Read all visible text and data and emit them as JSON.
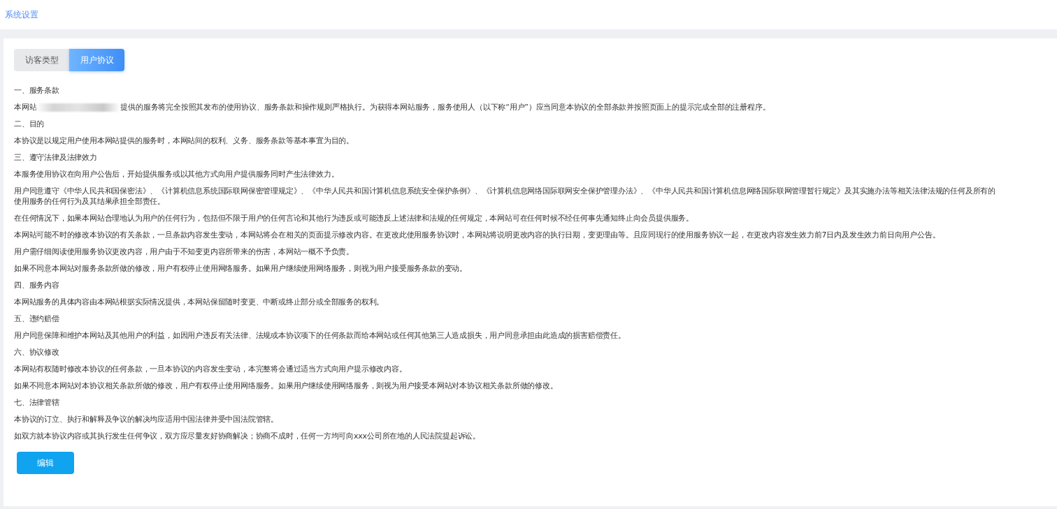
{
  "header": {
    "title": "系统设置"
  },
  "tabs": [
    {
      "label": "访客类型",
      "selected": false
    },
    {
      "label": "用户协议",
      "selected": true
    }
  ],
  "agreement": [
    {
      "kind": "heading",
      "text": "一、服务条款"
    },
    {
      "kind": "redacted",
      "before": "本网站",
      "after": "提供的服务将完全按照其发布的使用协议、服务条款和操作规则严格执行。为获得本网站服务，服务使用人（以下称“用户”）应当同意本协议的全部条款并按照页面上的提示完成全部的注册程序。"
    },
    {
      "kind": "heading",
      "text": "二、目的"
    },
    {
      "kind": "paragraph",
      "lines": [
        "本协议是以规定用户使用本网站提供的服务时，本网站间的权利、义务、服务条款等基本事宜为目的。"
      ]
    },
    {
      "kind": "heading",
      "text": "三、遵守法律及法律效力"
    },
    {
      "kind": "paragraph",
      "lines": [
        "本服务使用协议在向用户公告后，开始提供服务或以其他方式向用户提供服务同时产生法律效力。"
      ]
    },
    {
      "kind": "paragraph",
      "lines": [
        "用户同意遵守《中华人民共和国保密法》、《计算机信息系统国际联网保密管理规定》、《中华人民共和国计算机信息系统安全保护条例》、《计算机信息网络国际联网安全保护管理办法》、《中华人民共和国计算机信息网络国际联网管理暂行规定》及其实施办法等相关法律法规的任何及所有的",
        "使用服务的任何行为及其结果承担全部责任。"
      ]
    },
    {
      "kind": "paragraph",
      "lines": [
        "在任何情况下，如果本网站合理地认为用户的任何行为，包括但不限于用户的任何言论和其他行为违反或可能违反上述法律和法规的任何规定，本网站可在任何时候不经任何事先通知终止向会员提供服务。"
      ]
    },
    {
      "kind": "paragraph",
      "lines": [
        "本网站可能不时的修改本协议的有关条款，一旦条款内容发生变动，本网站将会在相关的页面提示修改内容。在更改此使用服务协议时，本网站将说明更改内容的执行日期，变更理由等。且应同现行的使用服务协议一起，在更改内容发生效力前7日内及发生效力前日向用户公告。"
      ]
    },
    {
      "kind": "paragraph",
      "lines": [
        "用户需仔细阅读使用服务协议更改内容，用户由于不知变更内容所带来的伤害，本网站一概不予负责。"
      ]
    },
    {
      "kind": "paragraph",
      "lines": [
        "如果不同意本网站对服务条款所做的修改，用户有权停止使用网络服务。如果用户继续使用网络服务，则视为用户接受服务条款的变动。"
      ]
    },
    {
      "kind": "heading",
      "text": "四、服务内容"
    },
    {
      "kind": "paragraph",
      "lines": [
        "本网站服务的具体内容由本网站根据实际情况提供，本网站保留随时变更、中断或终止部分或全部服务的权利。"
      ]
    },
    {
      "kind": "heading",
      "text": "五、违约赔偿"
    },
    {
      "kind": "paragraph",
      "lines": [
        "用户同意保障和维护本网站及其他用户的利益，如因用户违反有关法律、法规或本协议项下的任何条款而给本网站或任何其他第三人造成损失，用户同意承担由此造成的损害赔偿责任。"
      ]
    },
    {
      "kind": "heading",
      "text": "六、协议修改"
    },
    {
      "kind": "paragraph",
      "lines": [
        "本网站有权随时修改本协议的任何条款，一旦本协议的内容发生变动，本完整将会通过适当方式向用户提示修改内容。"
      ]
    },
    {
      "kind": "paragraph",
      "lines": [
        "如果不同意本网站对本协议相关条款所做的修改，用户有权停止使用网络服务。如果用户继续使用网络服务，则视为用户接受本网站对本协议相关条款所做的修改。"
      ]
    },
    {
      "kind": "heading",
      "text": "七、法律管辖"
    },
    {
      "kind": "paragraph",
      "lines": [
        "本协议的订立、执行和解释及争议的解决均应适用中国法律并受中国法院管辖。"
      ]
    },
    {
      "kind": "paragraph",
      "lines": [
        "如双方就本协议内容或其执行发生任何争议，双方应尽量友好协商解决；协商不成时，任何一方均可向xxx公司所在地的人民法院提起诉讼。"
      ]
    }
  ],
  "edit_button": "编辑"
}
